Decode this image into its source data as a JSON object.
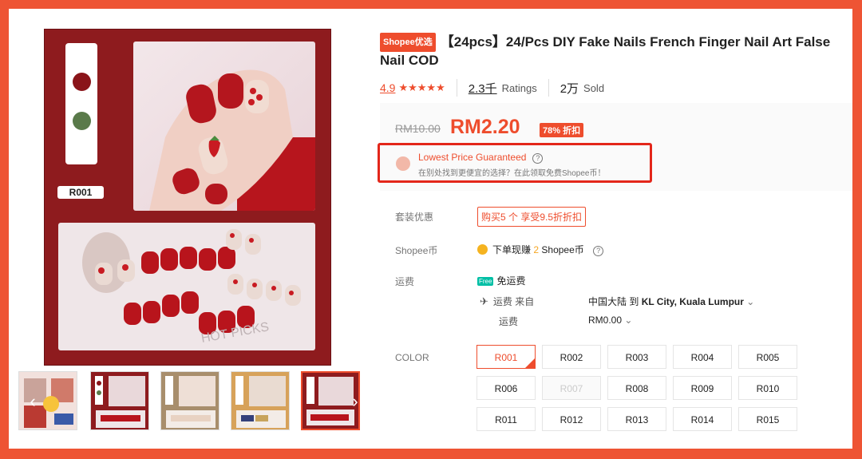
{
  "gallery": {
    "variant_code": "R001",
    "swatch_colors": [
      "#8a1419",
      "#5a7a4a"
    ],
    "watermark": "HOT PICKS",
    "thumb_prev": "‹",
    "thumb_next": "›"
  },
  "product": {
    "badge": "Shopee优选",
    "title": "【24pcs】24/Pcs DIY Fake Nails French Finger Nail Art False Nail COD"
  },
  "stats": {
    "rating": "4.9",
    "stars": "★★★★★",
    "ratings_count": "2.3千",
    "ratings_label": "Ratings",
    "sold_count": "2万",
    "sold_label": "Sold"
  },
  "price": {
    "original": "RM10.00",
    "current": "RM2.20",
    "discount": "78% 折扣"
  },
  "guarantee": {
    "title": "Lowest Price Guaranteed",
    "help": "?",
    "subtitle": "在别处找到更便宜的选择？在此领取免费Shopee币！"
  },
  "bundle": {
    "label": "套装优惠",
    "value": "购买5 个 享受9.5折折扣"
  },
  "coins": {
    "label": "Shopee币",
    "prefix": "下单现赚",
    "amount": "2",
    "suffix": "Shopee币",
    "help": "?"
  },
  "shipping": {
    "label": "运费",
    "free_badge": "Free",
    "free_text": "免运费",
    "from_label": "运费 来自",
    "from_value": "中国大陆 到",
    "destination": "KL City, Kuala Lumpur",
    "fee_label": "运费",
    "fee_value": "RM0.00"
  },
  "variants": {
    "label": "COLOR",
    "options": [
      "R001",
      "R002",
      "R003",
      "R004",
      "R005",
      "R006",
      "R007",
      "R008",
      "R009",
      "R010",
      "R011",
      "R012",
      "R013",
      "R014",
      "R015"
    ],
    "selected": "R001",
    "disabled": [
      "R007"
    ]
  },
  "colors": {
    "accent": "#ee4d2d",
    "frame": "#ee5434",
    "highlight_box": "#e3261a"
  }
}
